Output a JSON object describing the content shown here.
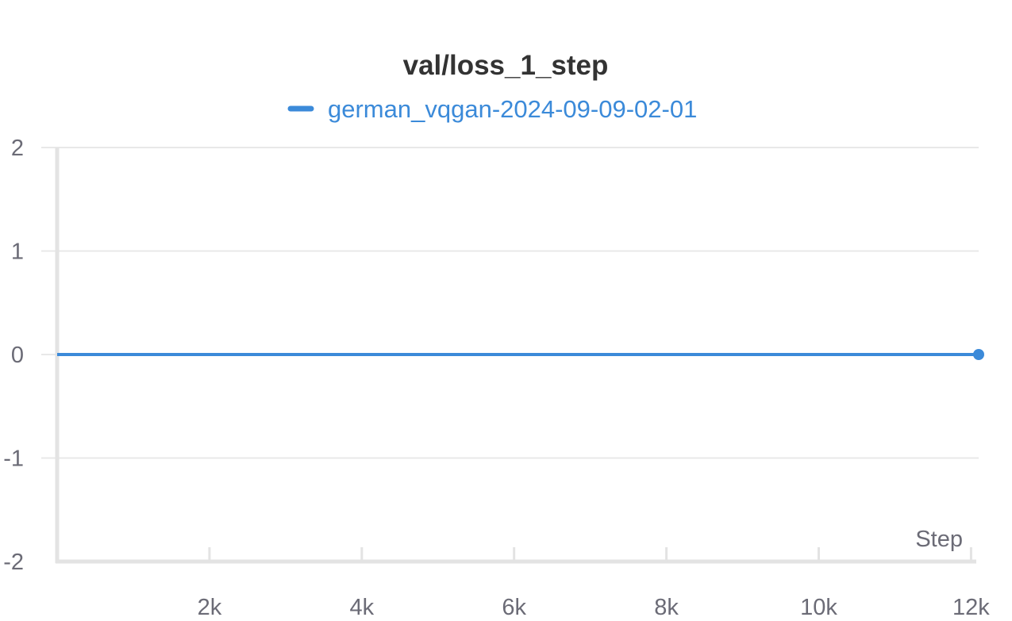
{
  "chart_data": {
    "type": "line",
    "title": "val/loss_1_step",
    "xlabel": "Step",
    "ylabel": "",
    "xlim": [
      0,
      12100
    ],
    "ylim": [
      -2,
      2
    ],
    "x_ticks": [
      2000,
      4000,
      6000,
      8000,
      10000,
      12000
    ],
    "x_tick_labels": [
      "2k",
      "4k",
      "6k",
      "8k",
      "10k",
      "12k"
    ],
    "y_ticks": [
      -2,
      -1,
      0,
      1,
      2
    ],
    "y_tick_labels": [
      "-2",
      "-1",
      "0",
      "1",
      "2"
    ],
    "grid": true,
    "legend_position": "top-center",
    "series": [
      {
        "name": "german_vqgan-2024-09-09-02-01",
        "color": "#3b8ad9",
        "x": [
          0,
          12100
        ],
        "y": [
          0,
          0
        ]
      }
    ]
  }
}
